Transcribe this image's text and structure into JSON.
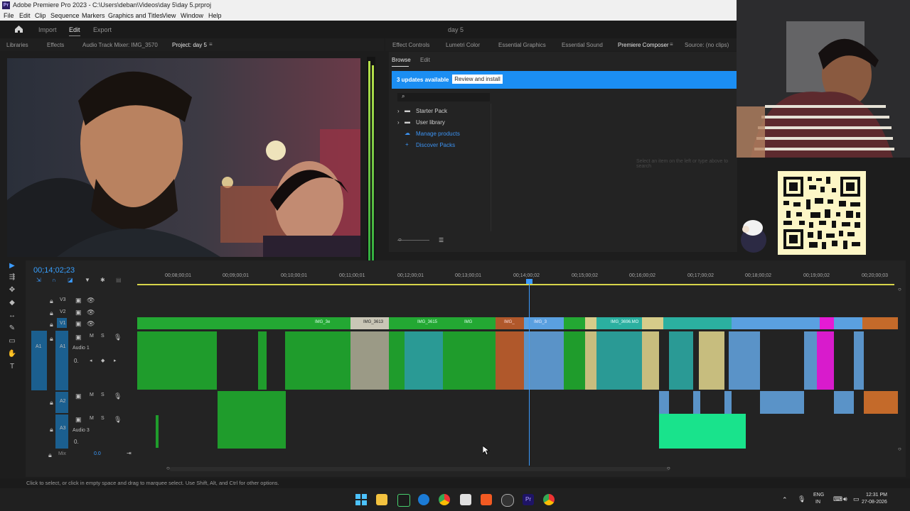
{
  "window": {
    "title": "Adobe Premiere Pro 2023 - C:\\Users\\deban\\Videos\\day 5\\day 5.prproj",
    "app_icon": "Pr"
  },
  "menu": [
    "File",
    "Edit",
    "Clip",
    "Sequence",
    "Markers",
    "Graphics and Titles",
    "View",
    "Window",
    "Help"
  ],
  "workspace": {
    "home_icon": "home-icon",
    "import": "Import",
    "edit": "Edit",
    "export": "Export",
    "project_name": "day 5"
  },
  "left_panel_tabs": [
    "Libraries",
    "Effects",
    "Audio Track Mixer: IMG_3570",
    "Project: day 5"
  ],
  "right_panel_tabs": [
    "Effect Controls",
    "Lumetri Color",
    "Essential Graphics",
    "Essential Sound",
    "Premiere Composer",
    "Source: (no clips)"
  ],
  "composer": {
    "subtabs": [
      "Browse",
      "Edit"
    ],
    "updates_text": "3 updates available",
    "review_button": "Review and install",
    "tree": [
      "Starter Pack",
      "User library",
      "Manage products",
      "Discover Packs"
    ],
    "hint": "Select an item on the left or type above to search"
  },
  "timeline": {
    "timecode": "00;14;02;23",
    "ruler": [
      "00;08;00;01",
      "00;09;00;01",
      "00;10;00;01",
      "00;11;00;01",
      "00;12;00;01",
      "00;13;00;01",
      "00;14;00;02",
      "00;15;00;02",
      "00;16;00;02",
      "00;17;00;02",
      "00;18;00;02",
      "00;19;00;02",
      "00;20;00;03"
    ],
    "tracks_video": [
      "V3",
      "V2",
      "V1"
    ],
    "tracks_audio": [
      {
        "id": "A1",
        "name": "Audio 1"
      },
      {
        "id": "A2",
        "name": ""
      },
      {
        "id": "A3",
        "name": "Audio 3"
      }
    ],
    "mix_label": "Mix",
    "mix_value": "0.0",
    "clip_labels": [
      "IMG_3e",
      "IMG_3613",
      "IMG_3615",
      "IMG",
      "IMG_",
      "IMG_3",
      "IMG_3696.MO"
    ],
    "track_buttons": {
      "mute": "M",
      "solo": "S"
    }
  },
  "status": "Click to select, or click in empty space and drag to marquee select. Use Shift, Alt, and Ctrl for other options.",
  "taskbar": {
    "lang1": "ENG",
    "lang2": "IN",
    "time": "12:31 PM",
    "date": "27-08-2026"
  }
}
